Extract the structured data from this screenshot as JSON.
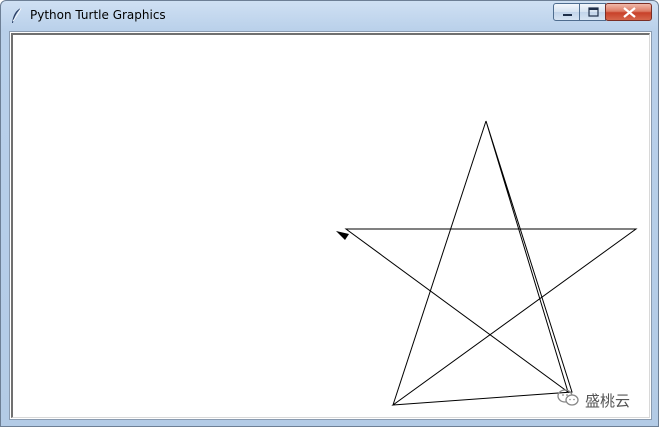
{
  "window": {
    "title": "Python Turtle Graphics",
    "icon": "feather-icon",
    "controls": {
      "minimize_icon": "minimize-icon",
      "maximize_icon": "maximize-icon",
      "close_icon": "close-icon"
    },
    "accent_close": "#c8412a",
    "frame_color": "#b9d0ea"
  },
  "canvas": {
    "background": "#ffffff",
    "stroke_color": "#000000",
    "drawing": "five-pointed star",
    "turtle_cursor": "arrow-cursor-icon"
  },
  "watermark": {
    "text": "盛桃云",
    "icon": "wechat-icon"
  }
}
